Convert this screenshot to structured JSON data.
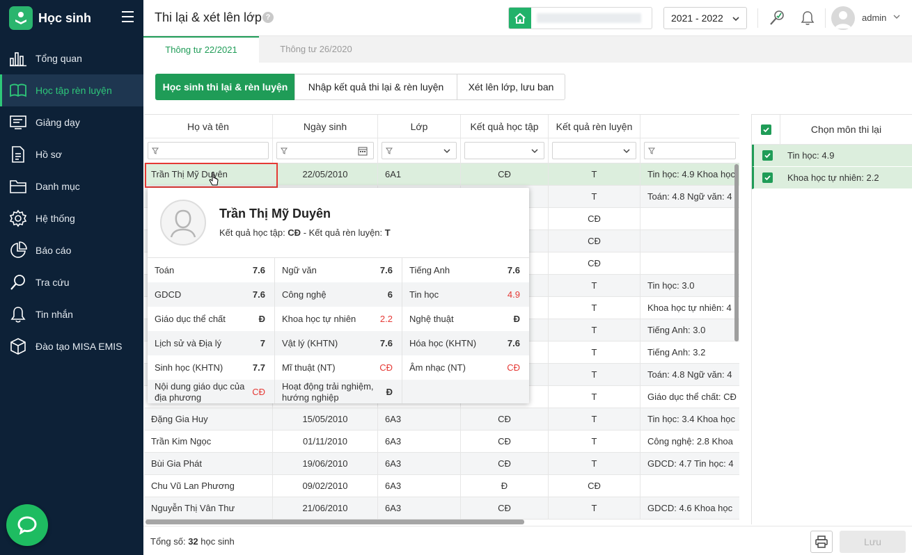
{
  "app": {
    "title": "Học sinh"
  },
  "sidebar": {
    "items": [
      {
        "label": "Tổng quan",
        "icon": "bar-chart-icon"
      },
      {
        "label": "Học tập rèn luyện",
        "icon": "book-open-icon",
        "active": true
      },
      {
        "label": "Giảng dạy",
        "icon": "chalkboard-icon"
      },
      {
        "label": "Hồ sơ",
        "icon": "document-icon"
      },
      {
        "label": "Danh mục",
        "icon": "folder-icon"
      },
      {
        "label": "Hệ thống",
        "icon": "gear-icon"
      },
      {
        "label": "Báo cáo",
        "icon": "pie-chart-icon"
      },
      {
        "label": "Tra cứu",
        "icon": "search-icon"
      },
      {
        "label": "Tin nhắn",
        "icon": "bell-icon"
      },
      {
        "label": "Đào tạo MISA EMIS",
        "icon": "cube-icon"
      }
    ]
  },
  "header": {
    "title": "Thi lại & xét lên lớp",
    "help": "?",
    "year": "2021 - 2022",
    "user": "admin"
  },
  "tabs": [
    "Thông tư 22/2021",
    "Thông tư 26/2020"
  ],
  "segments": [
    "Học sinh thi lại & rèn luyện",
    "Nhập kết quả thi lại & rèn luyện",
    "Xét lên lớp, lưu ban"
  ],
  "table": {
    "columns": [
      "Họ và tên",
      "Ngày sinh",
      "Lớp",
      "Kết quả học tập",
      "Kết quả rèn luyện",
      ""
    ],
    "rows": [
      {
        "name": "Trần Thị Mỹ Duyên",
        "dob": "22/05/2010",
        "class": "6A1",
        "result": "CĐ",
        "conduct": "T",
        "subjects": "Tin học: 4.9 Khoa học"
      },
      {
        "name": "",
        "dob": "",
        "class": "",
        "result": "",
        "conduct": "T",
        "subjects": "Toán: 4.8 Ngữ văn: 4"
      },
      {
        "name": "",
        "dob": "",
        "class": "",
        "result": "",
        "conduct": "CĐ",
        "subjects": ""
      },
      {
        "name": "",
        "dob": "",
        "class": "",
        "result": "",
        "conduct": "CĐ",
        "subjects": ""
      },
      {
        "name": "",
        "dob": "",
        "class": "",
        "result": "",
        "conduct": "CĐ",
        "subjects": ""
      },
      {
        "name": "",
        "dob": "",
        "class": "",
        "result": "",
        "conduct": "T",
        "subjects": "Tin học: 3.0"
      },
      {
        "name": "",
        "dob": "",
        "class": "",
        "result": "",
        "conduct": "T",
        "subjects": "Khoa học tự nhiên: 4"
      },
      {
        "name": "",
        "dob": "",
        "class": "",
        "result": "",
        "conduct": "T",
        "subjects": "Tiếng Anh: 3.0"
      },
      {
        "name": "",
        "dob": "",
        "class": "",
        "result": "",
        "conduct": "T",
        "subjects": "Tiếng Anh: 3.2"
      },
      {
        "name": "",
        "dob": "",
        "class": "",
        "result": "",
        "conduct": "T",
        "subjects": "Toán: 4.8 Ngữ văn: 4"
      },
      {
        "name": "",
        "dob": "",
        "class": "",
        "result": "",
        "conduct": "T",
        "subjects": "Giáo dục thể chất: CĐ"
      },
      {
        "name": "Đặng Gia Huy",
        "dob": "15/05/2010",
        "class": "6A3",
        "result": "CĐ",
        "conduct": "T",
        "subjects": "Tin học: 3.4 Khoa học"
      },
      {
        "name": "Trần Kim Ngọc",
        "dob": "01/11/2010",
        "class": "6A3",
        "result": "CĐ",
        "conduct": "T",
        "subjects": "Công nghệ: 2.8 Khoa"
      },
      {
        "name": "Bùi Gia Phát",
        "dob": "19/06/2010",
        "class": "6A3",
        "result": "CĐ",
        "conduct": "T",
        "subjects": "GDCD: 4.7 Tin học: 4"
      },
      {
        "name": "Chu Vũ Lan Phương",
        "dob": "09/02/2010",
        "class": "6A3",
        "result": "Đ",
        "conduct": "CĐ",
        "subjects": ""
      },
      {
        "name": "Nguyễn Thị Vân Thư",
        "dob": "21/06/2010",
        "class": "6A3",
        "result": "CĐ",
        "conduct": "T",
        "subjects": "GDCD: 4.6 Khoa học"
      }
    ]
  },
  "popup": {
    "name": "Trần Thị Mỹ Duyên",
    "result_prefix": "Kết quả học tập: ",
    "result_value": "CĐ",
    "conduct_prefix": " - Kết quả rèn luyện: ",
    "conduct_value": "T",
    "grades": [
      [
        {
          "subject": "Toán",
          "score": "7.6"
        },
        {
          "subject": "Ngữ văn",
          "score": "7.6"
        },
        {
          "subject": "Tiếng Anh",
          "score": "7.6"
        }
      ],
      [
        {
          "subject": "GDCD",
          "score": "7.6"
        },
        {
          "subject": "Công nghệ",
          "score": "6"
        },
        {
          "subject": "Tin học",
          "score": "4.9",
          "fail": true
        }
      ],
      [
        {
          "subject": "Giáo dục thể chất",
          "score": "Đ"
        },
        {
          "subject": "Khoa học tự nhiên",
          "score": "2.2",
          "fail": true
        },
        {
          "subject": "Nghệ thuật",
          "score": "Đ"
        }
      ],
      [
        {
          "subject": "Lịch sử và Địa lý",
          "score": "7"
        },
        {
          "subject": "Vật lý (KHTN)",
          "score": "7.6"
        },
        {
          "subject": "Hóa học (KHTN)",
          "score": "7.6"
        }
      ],
      [
        {
          "subject": "Sinh học (KHTN)",
          "score": "7.7"
        },
        {
          "subject": "Mĩ thuật (NT)",
          "score": "CĐ",
          "fail": true
        },
        {
          "subject": "Âm nhạc (NT)",
          "score": "CĐ",
          "fail": true
        }
      ],
      [
        {
          "subject": "Nội dung giáo dục của địa phương",
          "score": "CĐ",
          "fail": true
        },
        {
          "subject": "Hoạt động trải nghiệm, hướng nghiệp",
          "score": "Đ"
        },
        {
          "subject": "",
          "score": ""
        }
      ]
    ]
  },
  "right_panel": {
    "title": "Chọn môn thi lại",
    "items": [
      "Tin học: 4.9",
      "Khoa học tự nhiên: 2.2"
    ]
  },
  "footer": {
    "total_prefix": "Tổng số: ",
    "total_count": "32",
    "total_suffix": " học sinh",
    "save_label": "Lưu"
  },
  "colors": {
    "primary": "#1f9c57",
    "sidebar": "#0d2137",
    "fail": "#e53935"
  }
}
